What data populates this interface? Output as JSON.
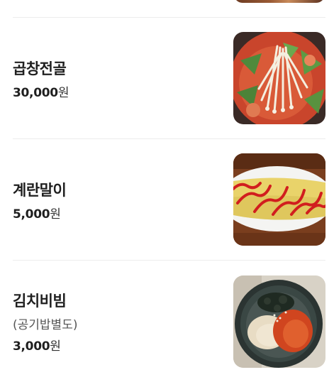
{
  "menu": {
    "items": [
      {
        "name": "곱창전골",
        "price": "30,000",
        "currency": "원",
        "image": "gopchang-jeongol-photo"
      },
      {
        "name": "계란말이",
        "price": "5,000",
        "currency": "원",
        "image": "gyeran-mari-photo"
      },
      {
        "name": "김치비빔",
        "note": "(공기밥별도)",
        "price": "3,000",
        "currency": "원",
        "image": "kimchi-bibim-photo"
      }
    ]
  }
}
